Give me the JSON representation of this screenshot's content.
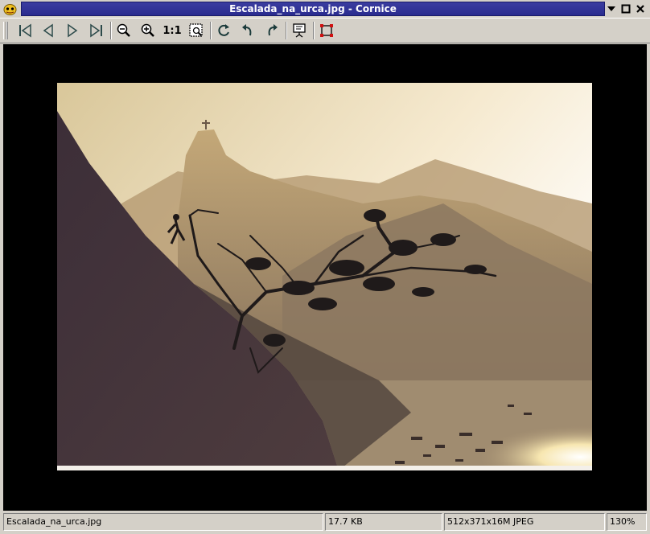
{
  "window": {
    "title": "Escalada_na_urca.jpg - Cornice",
    "buttons": [
      "menu-arrow-icon",
      "maximize-icon",
      "close-icon"
    ]
  },
  "toolbar": {
    "buttons": [
      {
        "name": "first-image",
        "icon": "skip-first-icon"
      },
      {
        "name": "previous-image",
        "icon": "arrow-left-icon"
      },
      {
        "name": "next-image",
        "icon": "arrow-right-icon"
      },
      {
        "name": "last-image",
        "icon": "skip-last-icon"
      },
      {
        "name": "zoom-out",
        "icon": "zoom-out-icon"
      },
      {
        "name": "zoom-in",
        "icon": "zoom-in-icon"
      },
      {
        "name": "zoom-1-1",
        "label": "1:1"
      },
      {
        "name": "zoom-fit",
        "icon": "zoom-fit-icon"
      },
      {
        "name": "rotate",
        "icon": "rotate-icon"
      },
      {
        "name": "undo",
        "icon": "undo-icon"
      },
      {
        "name": "redo",
        "icon": "redo-icon"
      },
      {
        "name": "slideshow",
        "icon": "slideshow-icon"
      },
      {
        "name": "fullscreen",
        "icon": "fullscreen-icon"
      }
    ]
  },
  "status": {
    "filename": "Escalada_na_urca.jpg",
    "filesize": "17.7 KB",
    "image_info": "512x371x16M JPEG",
    "zoom": "130%"
  },
  "colors": {
    "title_active": "#2a2c8f",
    "chrome": "#d4d0c8",
    "viewer_bg": "#000000",
    "fullscreen_accent": "#d01010"
  }
}
